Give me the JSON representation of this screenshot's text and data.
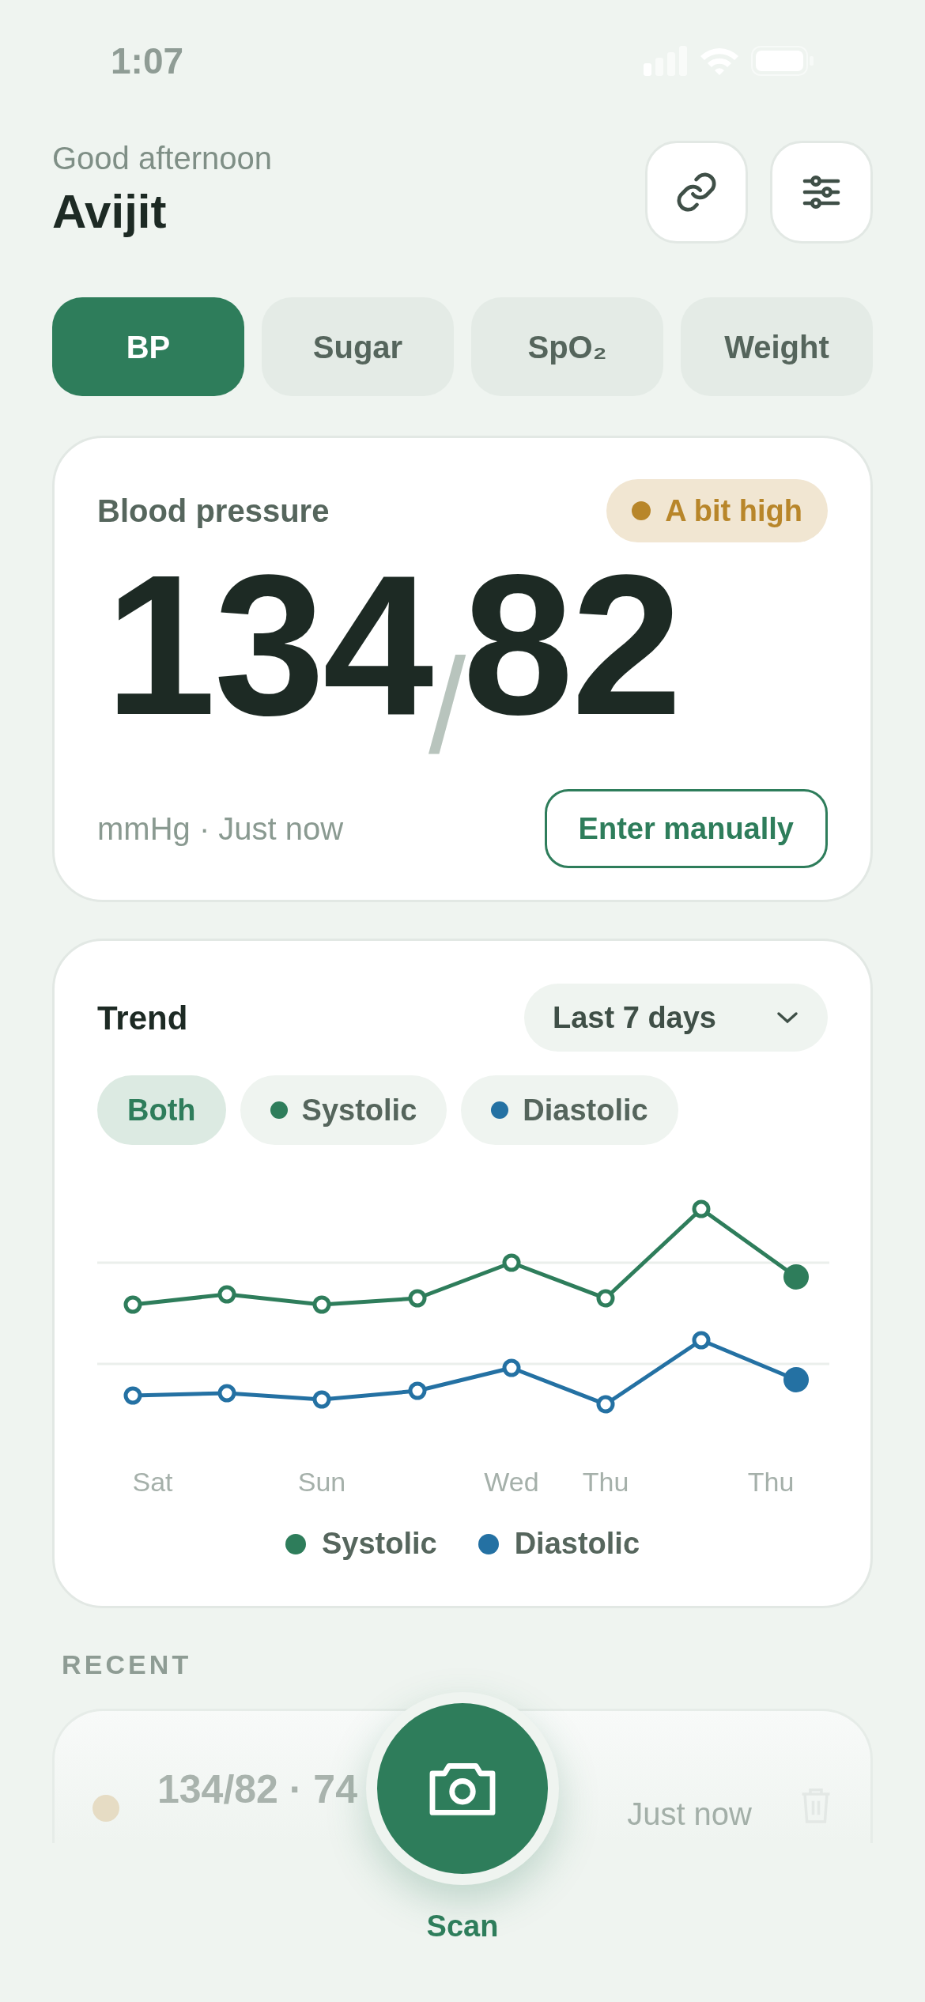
{
  "status_bar": {
    "time": "1:07"
  },
  "header": {
    "greeting": "Good afternoon",
    "name": "Avijit"
  },
  "tabs": [
    {
      "label": "BP",
      "selected": true
    },
    {
      "label": "Sugar",
      "selected": false
    },
    {
      "label": "SpO₂",
      "selected": false
    },
    {
      "label": "Weight",
      "selected": false
    }
  ],
  "reading_card": {
    "title": "Blood pressure",
    "badge": {
      "label": "A bit high",
      "color": "#b8862a"
    },
    "systolic": "134",
    "separator": "/",
    "diastolic": "82",
    "meta": "mmHg · Just now",
    "button": "Enter manually"
  },
  "trend_card": {
    "title": "Trend",
    "range": "Last 7 days",
    "filters": [
      {
        "label": "Both",
        "selected": true
      },
      {
        "label": "Systolic",
        "selected": false,
        "color": "#2e7d5b"
      },
      {
        "label": "Diastolic",
        "selected": false,
        "color": "#2471a3"
      }
    ],
    "x_labels": [
      "Sat",
      "Sun",
      "Wed",
      "Thu",
      "Thu"
    ],
    "legend": [
      {
        "label": "Systolic",
        "color": "#2e7d5b"
      },
      {
        "label": "Diastolic",
        "color": "#2471a3"
      }
    ]
  },
  "recent": {
    "heading": "RECENT",
    "items": [
      {
        "reading": "134/82 · 74",
        "time": "Just now",
        "color": "#e6dcc4"
      }
    ]
  },
  "scan": {
    "label": "Scan"
  }
}
